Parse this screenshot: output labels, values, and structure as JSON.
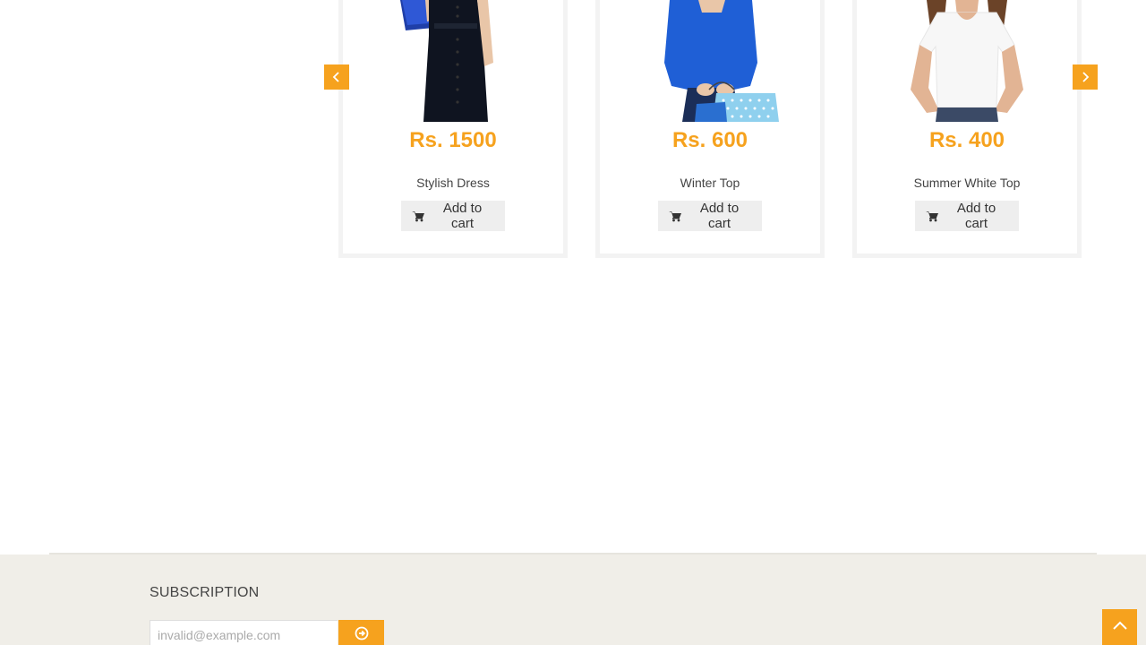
{
  "carousel": {
    "prev_icon": "chevron-left-icon",
    "next_icon": "chevron-right-icon",
    "products": [
      {
        "price": "Rs. 1500",
        "name": "Stylish Dress",
        "button": "Add to cart"
      },
      {
        "price": "Rs. 600",
        "name": "Winter Top",
        "button": "Add to cart"
      },
      {
        "price": "Rs. 400",
        "name": "Summer White Top",
        "button": "Add to cart"
      }
    ]
  },
  "footer": {
    "subscription_title": "SUBSCRIPTION",
    "email_placeholder": "invalid@example.com",
    "submit_icon": "arrow-circle-right-icon",
    "back_to_top_icon": "chevron-up-icon"
  },
  "colors": {
    "accent": "#f6a21e",
    "footer_bg": "#f0eee8",
    "button_bg": "#eeeeee"
  }
}
